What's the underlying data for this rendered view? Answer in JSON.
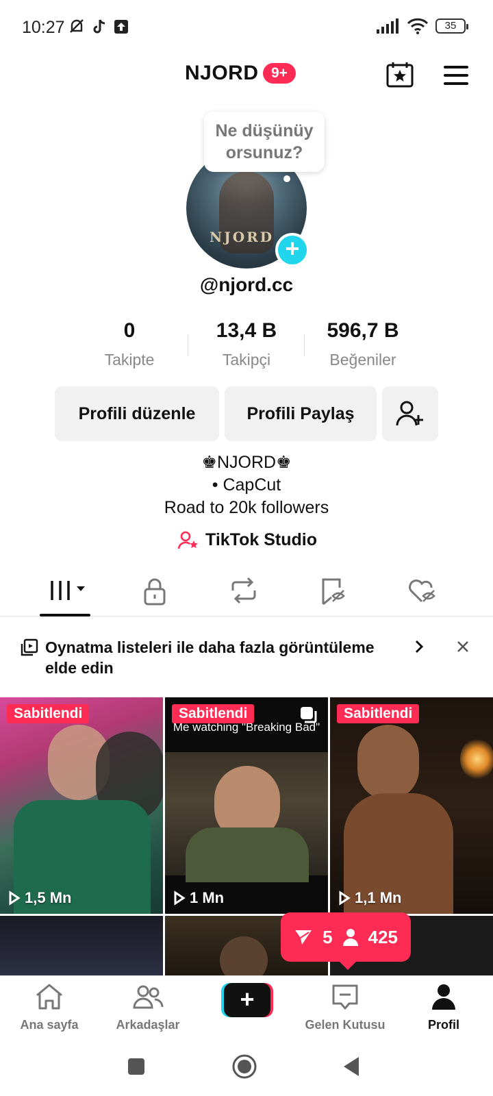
{
  "status_bar": {
    "time": "10:27",
    "battery": "35"
  },
  "header": {
    "title": "NJORD",
    "badge": "9+"
  },
  "profile": {
    "bubble": "Ne düşünüy orsunuz?",
    "avatar_text": "NJORD",
    "username": "@njord.cc",
    "stats": [
      {
        "value": "0",
        "label": "Takipte"
      },
      {
        "value": "13,4 B",
        "label": "Takipçi"
      },
      {
        "value": "596,7 B",
        "label": "Beğeniler"
      }
    ],
    "edit_button": "Profili düzenle",
    "share_button": "Profili Paylaş",
    "bio": [
      "♚NJORD♚",
      "• CapCut",
      "Road to 20k followers"
    ],
    "studio": "TikTok Studio"
  },
  "banner": {
    "text": "Oynatma listeleri ile daha fazla görüntüleme elde edin"
  },
  "videos": [
    {
      "pinned": "Sabitlendi",
      "views": "1,5 Mn",
      "caption": ""
    },
    {
      "pinned": "Sabitlendi",
      "views": "1 Mn",
      "caption": "Me watching \"Breaking Bad\""
    },
    {
      "pinned": "Sabitlendi",
      "views": "1,1 Mn",
      "caption": ""
    }
  ],
  "popup": {
    "shares": "5",
    "followers": "425"
  },
  "bottom_nav": {
    "home": "Ana sayfa",
    "friends": "Arkadaşlar",
    "inbox": "Gelen Kutusu",
    "profile": "Profil"
  },
  "colors": {
    "accent": "#fe2c55",
    "cyan": "#20d5ec"
  }
}
